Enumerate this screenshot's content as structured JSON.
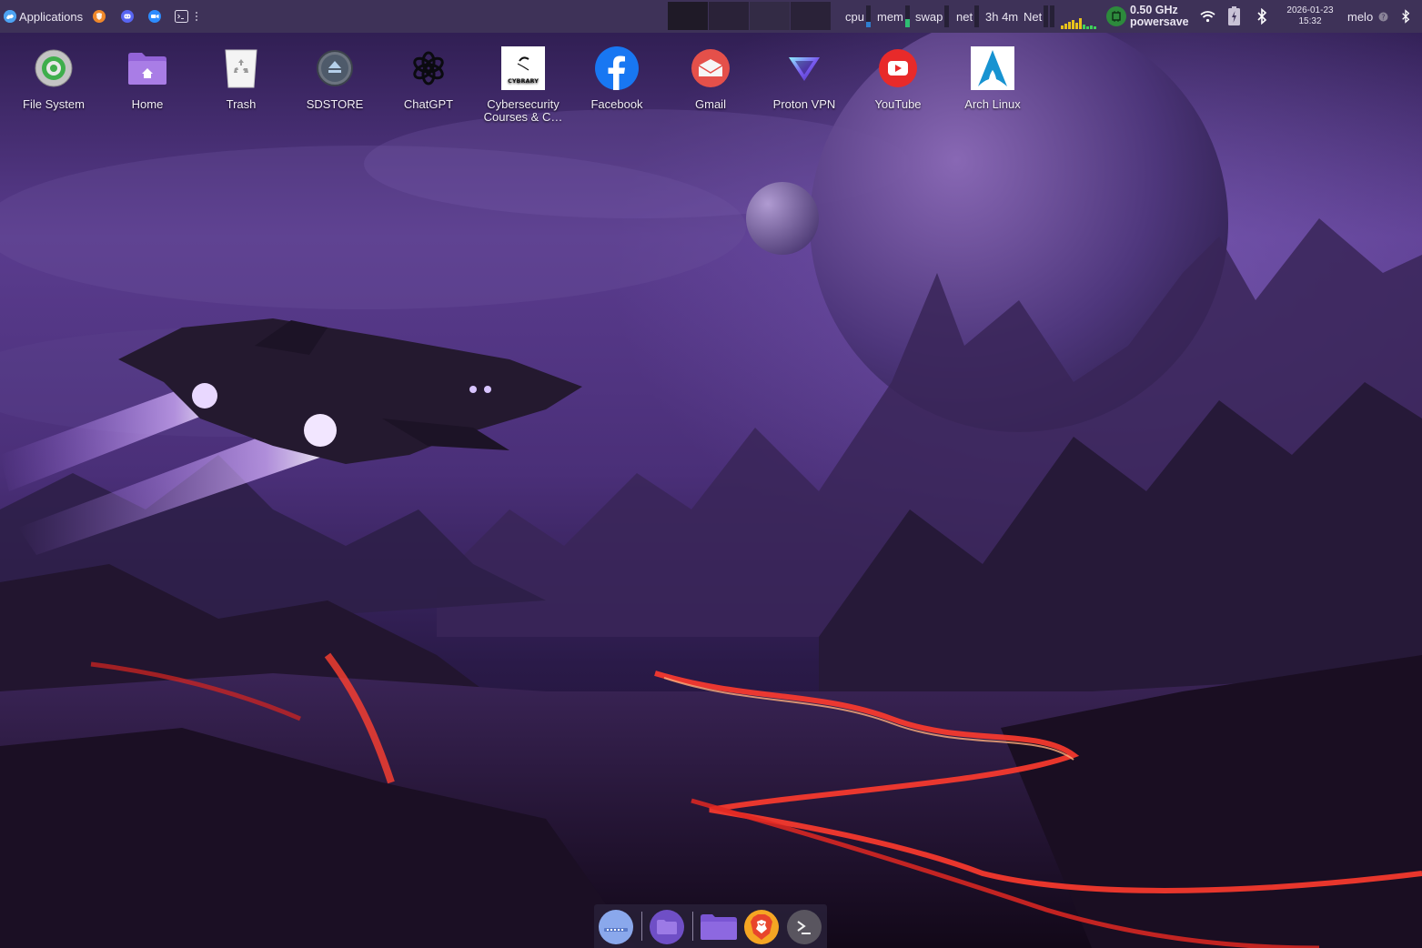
{
  "panel": {
    "applications_label": "Applications",
    "launchers": [
      "brave-icon",
      "discord-icon",
      "zoom-icon",
      "terminal-icon",
      "overflow-icon"
    ],
    "monitors": {
      "cpu_label": "cpu",
      "mem_label": "mem",
      "swap_label": "swap",
      "net_label": "net",
      "uptime": "3h 4m",
      "net2_label": "Net"
    },
    "cpufreq": {
      "frequency": "0.50 GHz",
      "governor": "powersave"
    },
    "clock": {
      "date": "2026-01-23",
      "time": "15:32"
    },
    "user": "melo",
    "tray": [
      "wifi-icon",
      "battery-icon",
      "bluetooth-icon"
    ]
  },
  "desktop": {
    "icons": [
      {
        "label": "File System",
        "icon": "filesystem-icon"
      },
      {
        "label": "Home",
        "icon": "home-folder-icon"
      },
      {
        "label": "Trash",
        "icon": "trash-icon"
      },
      {
        "label": "SDSTORE",
        "icon": "drive-eject-icon"
      },
      {
        "label": "ChatGPT",
        "icon": "chatgpt-icon"
      },
      {
        "label": "Cybersecurity Courses & C…",
        "icon": "cybrary-icon",
        "logo_text": "CYBRARY"
      },
      {
        "label": "Facebook",
        "icon": "facebook-icon"
      },
      {
        "label": "Gmail",
        "icon": "gmail-icon"
      },
      {
        "label": "Proton VPN",
        "icon": "protonvpn-icon"
      },
      {
        "label": "YouTube",
        "icon": "youtube-icon"
      },
      {
        "label": "Arch Linux",
        "icon": "arch-linux-icon"
      }
    ]
  },
  "dock": {
    "items": [
      "show-desktop-icon",
      "files-icon",
      "folder-icon",
      "brave-icon",
      "terminal-icon"
    ]
  },
  "colors": {
    "panel_bg": "#3e3258",
    "accent_purple": "#7a5fd6",
    "cpu_graph": "#2f7fd0",
    "mem_graph": "#2fbf73",
    "net_graph_yellow": "#e8c21b",
    "net_graph_green": "#3fd15a"
  }
}
